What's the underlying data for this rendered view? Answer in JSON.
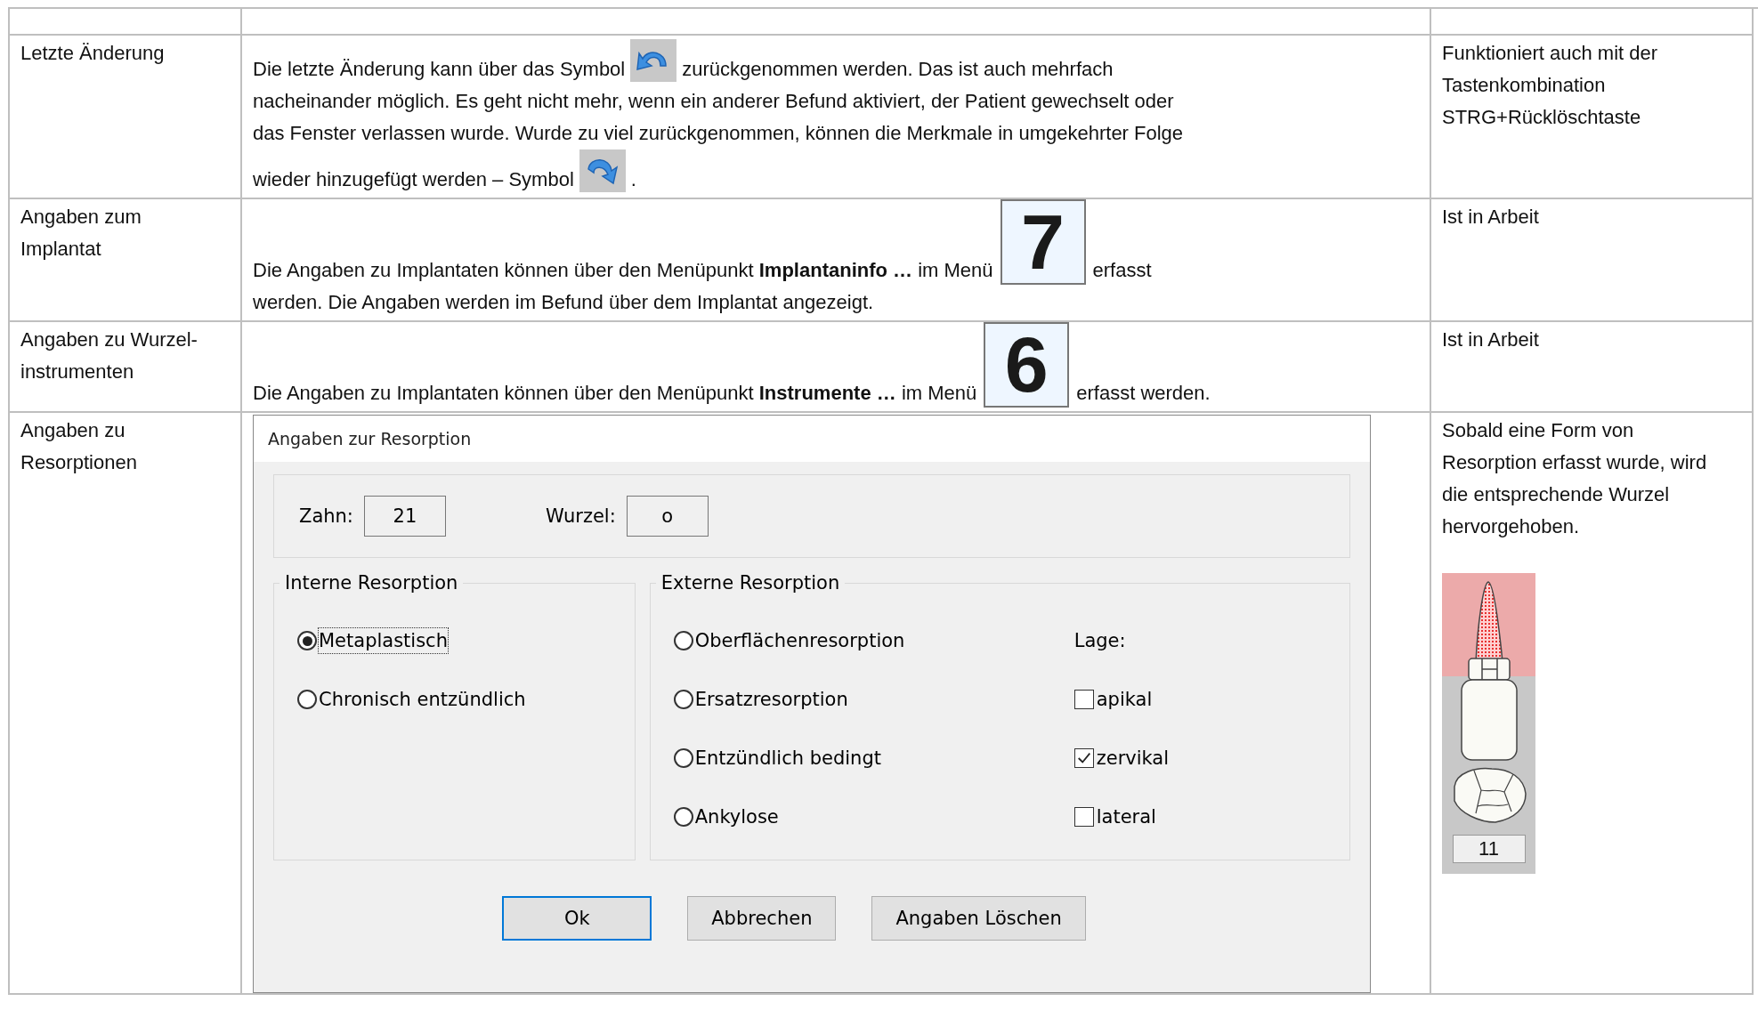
{
  "rows": [
    {
      "label": "Letzte Änderung",
      "lines": [
        [
          {
            "kind": "text",
            "text": "Die letzte Änderung kann über das Symbol"
          },
          {
            "kind": "undo"
          },
          {
            "kind": "text",
            "text": "zurückgenommen werden. Das ist auch mehrfach"
          }
        ],
        [
          {
            "kind": "text",
            "text": "nacheinander möglich. Es geht nicht mehr, wenn ein anderer Befund aktiviert, der Patient gewechselt oder"
          }
        ],
        [
          {
            "kind": "text",
            "text": "das Fenster verlassen wurde. Wurde zu viel zurückgenommen, können die Merkmale in umgekehrter Folge"
          }
        ],
        [
          {
            "kind": "text",
            "text": "wieder hinzugefügt werden – Symbol"
          },
          {
            "kind": "redo"
          },
          {
            "kind": "text",
            "text": "."
          }
        ]
      ],
      "note": "Funktioniert auch mit der Tastenkombination STRG+Rücklöschtaste"
    },
    {
      "label": "Angaben zum Implantat",
      "lines": [
        [
          {
            "kind": "text",
            "text": "Die Angaben zu Implantaten können über den Menüpunkt **Implantaninfo …** im Menü"
          },
          {
            "kind": "key",
            "text": "7"
          },
          {
            "kind": "text",
            "text": "erfasst"
          }
        ],
        [
          {
            "kind": "text",
            "text": "werden. Die Angaben werden im Befund über dem Implantat angezeigt."
          }
        ]
      ],
      "note": "Ist in Arbeit"
    },
    {
      "label": "Angaben zu Wurzel-instrumenten",
      "lines": [
        [
          {
            "kind": "text",
            "text": "Die Angaben zu Implantaten können über den Menüpunkt **Instrumente …** im Menü"
          },
          {
            "kind": "key",
            "text": "6"
          },
          {
            "kind": "text",
            "text": "erfasst werden."
          }
        ]
      ],
      "note": "Ist in Arbeit"
    },
    {
      "label": "Angaben zu Resorptionen",
      "dialog": {
        "title": "Angaben zur Resorption",
        "fields": [
          {
            "label": "Zahn:",
            "value": "21"
          },
          {
            "label": "Wurzel:",
            "value": "o"
          }
        ],
        "internal": {
          "title": "Interne Resorption",
          "options": [
            {
              "label": "Metaplastisch",
              "selected": true
            },
            {
              "label": "Chronisch entzündlich",
              "selected": false
            }
          ]
        },
        "external": {
          "title": "Externe Resorption",
          "options": [
            {
              "label": "Oberflächenresorption",
              "selected": false
            },
            {
              "label": "Ersatzresorption",
              "selected": false
            },
            {
              "label": "Entzündlich bedingt",
              "selected": false
            },
            {
              "label": "Ankylose",
              "selected": false
            }
          ],
          "location_label": "Lage:",
          "locations": [
            {
              "label": "apikal",
              "checked": false
            },
            {
              "label": "zervikal",
              "checked": true
            },
            {
              "label": "lateral",
              "checked": false
            }
          ]
        },
        "buttons": [
          {
            "label": "Ok",
            "default": true
          },
          {
            "label": "Abbrechen",
            "default": false
          },
          {
            "label": "Angaben Löschen",
            "default": false
          }
        ]
      },
      "note": "Sobald eine Form von Resorption erfasst wurde, wird die entsprechende Wurzel hervorgehoben.",
      "tooth_number": "11"
    }
  ]
}
